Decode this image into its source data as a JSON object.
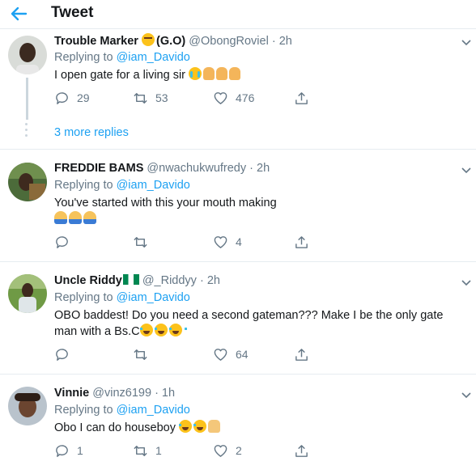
{
  "header": {
    "title": "Tweet"
  },
  "tweets": [
    {
      "name": "Trouble Marker",
      "name_suffix": "(G.O)",
      "handle": "@ObongRoviel",
      "time": "· 2h",
      "replying_prefix": "Replying to",
      "replying_to": "@iam_Davido",
      "text": "I open gate for a living sir",
      "emojis": [
        "loudly-crying-face",
        "folded-hands",
        "folded-hands",
        "folded-hands"
      ],
      "replies": "29",
      "retweets": "53",
      "likes": "476"
    },
    {
      "name": "FREDDIE BAMS",
      "handle": "@nwachukwufredy",
      "time": "· 2h",
      "replying_prefix": "Replying to",
      "replying_to": "@iam_Davido",
      "text": "You've started with this your mouth making",
      "emojis": [
        "person-facepalming",
        "person-facepalming",
        "person-facepalming"
      ],
      "replies": "",
      "retweets": "",
      "likes": "4"
    },
    {
      "name": "Uncle Riddy",
      "handle": "@_Riddyy",
      "time": "· 2h",
      "replying_prefix": "Replying to",
      "replying_to": "@iam_Davido",
      "text_line1": "OBO baddest! Do you need a second gateman??? Make I be the only gate",
      "text_line2": "man with a Bs.C",
      "emojis": [
        "nigeria-flag",
        "face-with-tears-of-joy",
        "face-with-tears-of-joy",
        "face-with-tears-of-joy"
      ],
      "replies": "",
      "retweets": "",
      "likes": "64"
    },
    {
      "name": "Vinnie",
      "handle": "@vinz6199",
      "time": "· 1h",
      "replying_prefix": "Replying to",
      "replying_to": "@iam_Davido",
      "text": "Obo I can do houseboy",
      "emojis": [
        "face-with-tears-of-joy",
        "face-with-tears-of-joy",
        "raising-hands"
      ],
      "replies": "1",
      "retweets": "1",
      "likes": "2"
    }
  ],
  "more_replies": "3 more replies",
  "colors": {
    "accent": "#1da1f2",
    "secondary_text": "#657786",
    "divider": "#e6ecf0"
  }
}
